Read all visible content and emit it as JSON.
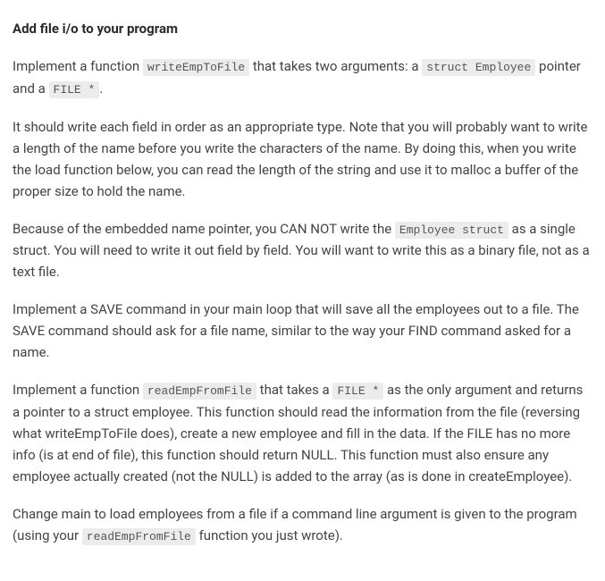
{
  "heading": "Add file i/o to your program",
  "p1": {
    "t1": "Implement a function ",
    "c1": "writeEmpToFile",
    "t2": " that takes two arguments: a ",
    "c2": "struct Employee",
    "t3": " pointer and a ",
    "c3": "FILE *",
    "t4": "."
  },
  "p2": "It should write each field in order as an appropriate type. Note that you will probably want to write a length of the name before you write the characters of the name. By doing this, when you write the load function below, you can read the length of the string and use it to malloc a buffer of the proper size to hold the name.",
  "p3": {
    "t1": "Because of the embedded name pointer, you CAN NOT write the ",
    "c1": "Employee struct",
    "t2": " as a single struct. You will need to write it out field by field. You will want to write this as a binary file, not as a text file."
  },
  "p4": "Implement a SAVE command in your main loop that will save all the employees out to a file. The SAVE command should ask for a file name, similar to the way your FIND command asked for a name.",
  "p5": {
    "t1": "Implement a function ",
    "c1": "readEmpFromFile",
    "t2": " that takes a ",
    "c2": "FILE *",
    "t3": " as the only argument and returns a pointer to a struct employee. This function should read the information from the file (reversing what writeEmpToFile does), create a new employee and fill in the data. If the FILE has no more info (is at end of file), this function should return NULL. This function must also ensure any employee actually created (not the NULL) is added to the array (as is done in createEmployee)."
  },
  "p6": {
    "t1": "Change main to load employees from a file if a command line argument is given to the program (using your ",
    "c1": "readEmpFromFile",
    "t2": " function you just wrote)."
  }
}
